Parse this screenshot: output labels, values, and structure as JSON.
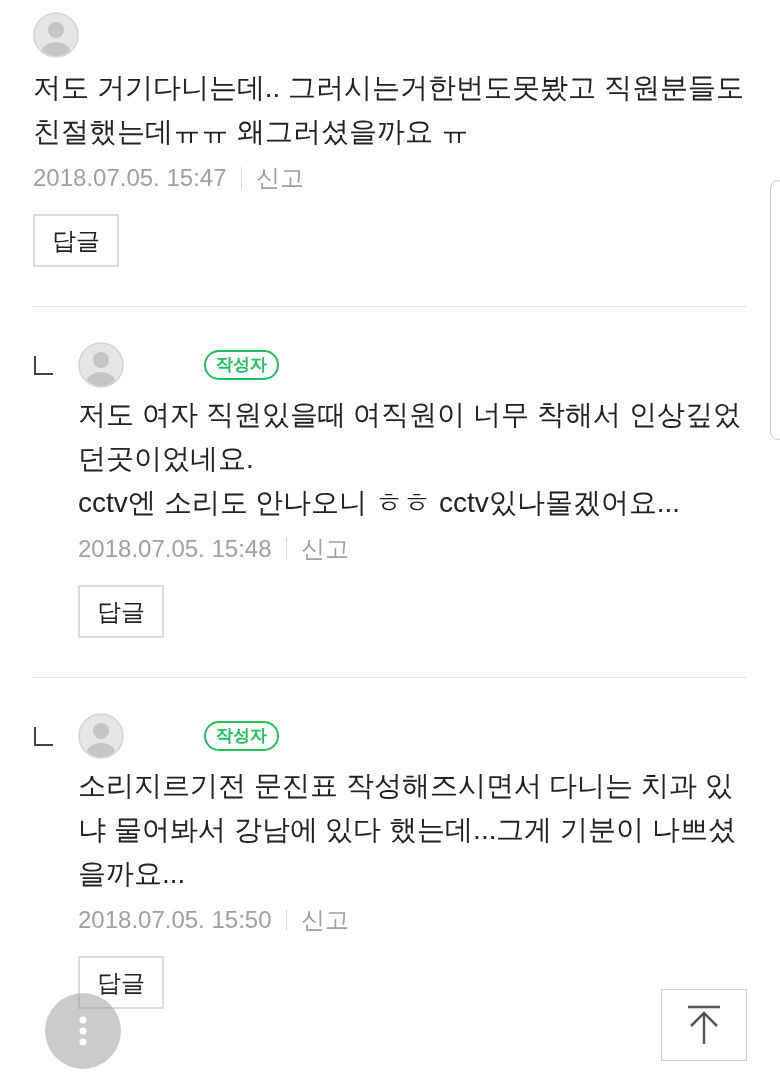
{
  "comments": [
    {
      "kind": "comment",
      "text": "저도 거기다니는데.. 그러시는거한번도못봤고 직원분들도 친절했는데ㅠㅠ 왜그러셨을까요 ㅠ",
      "date": "2018.07.05. 15:47",
      "report": "신고",
      "reply_button": "답글"
    },
    {
      "kind": "reply",
      "badge": "작성자",
      "text": "저도 여자 직원있을때 여직원이 너무 착해서 인상깊었던곳이었네요.\ncctv엔 소리도 안나오니 ㅎㅎ cctv있나몰겠어요...",
      "date": "2018.07.05. 15:48",
      "report": "신고",
      "reply_button": "답글"
    },
    {
      "kind": "reply",
      "badge": "작성자",
      "text": "소리지르기전 문진표 작성해즈시면서 다니는 치과 있냐 물어봐서 강남에 있다 했는데...그게 기분이 나쁘셨을까요...",
      "date": "2018.07.05. 15:50",
      "report": "신고",
      "reply_button": "답글"
    }
  ]
}
